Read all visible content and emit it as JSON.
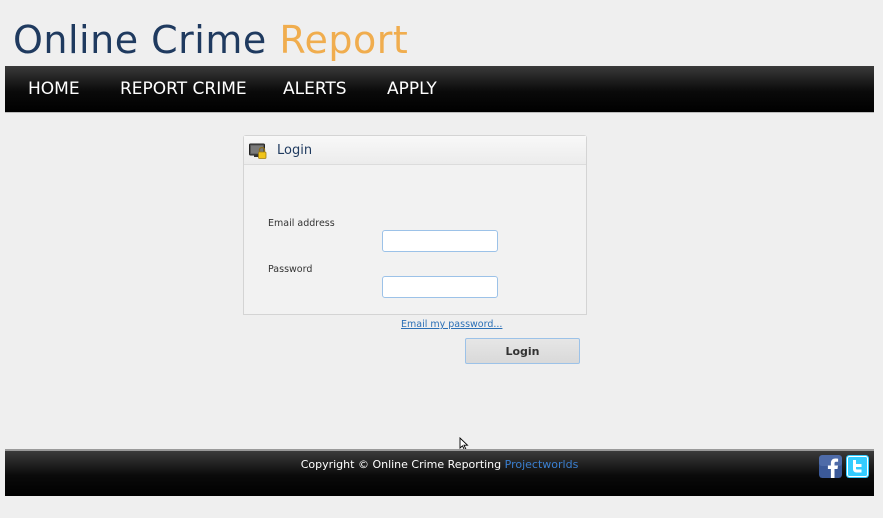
{
  "header": {
    "title_part1": "Online Crime",
    "title_part2": "Report"
  },
  "nav": {
    "items": [
      {
        "label": "HOME"
      },
      {
        "label": "REPORT CRIME"
      },
      {
        "label": "ALERTS"
      },
      {
        "label": "APPLY"
      }
    ]
  },
  "login": {
    "title": "Login",
    "email_label": "Email address",
    "email_value": "",
    "password_label": "Password",
    "password_value": "",
    "forgot_link": "Email my password...",
    "submit_label": "Login"
  },
  "footer": {
    "copyright_text": "Copyright © Online Crime Reporting",
    "brand_link": "Projectworlds",
    "social": [
      {
        "icon": "facebook-icon",
        "color": "#3b5998"
      },
      {
        "icon": "twitter-icon",
        "color": "#33ccff"
      }
    ]
  },
  "colors": {
    "title_dark": "#1f3a5f",
    "title_accent": "#f0ad4e",
    "link": "#2a6fb6",
    "input_border": "#9cc2e8"
  }
}
